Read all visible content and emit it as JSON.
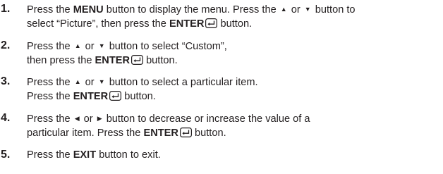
{
  "steps": [
    {
      "num": "1.",
      "lines": [
        [
          "Press the ",
          "MENU",
          " button to display the menu. Press the ",
          "▲",
          " or ",
          "▼",
          " button to"
        ],
        [
          "select “Picture”, then press the ",
          "ENTER",
          " button."
        ]
      ]
    },
    {
      "num": "2.",
      "lines": [
        [
          "Press the ",
          "▲",
          " or ",
          "▼",
          " button to select “Custom”,"
        ],
        [
          "then press the ",
          "ENTER",
          " button."
        ]
      ]
    },
    {
      "num": "3.",
      "lines": [
        [
          "Press the ",
          "▲",
          " or ",
          "▼",
          " button to select a particular item."
        ],
        [
          "Press the ",
          "ENTER",
          " button."
        ]
      ]
    },
    {
      "num": "4.",
      "lines": [
        [
          "Press the ",
          "◀",
          " or ",
          "▶",
          " button to decrease or increase the value of a"
        ],
        [
          "particular item. Press the ",
          "ENTER",
          " button."
        ]
      ]
    },
    {
      "num": "5.",
      "lines": [
        [
          "Press the ",
          "EXIT",
          " button to exit."
        ]
      ]
    }
  ],
  "icons": {
    "enter": "enter-key-icon",
    "up": "up-arrow-icon",
    "down": "down-arrow-icon",
    "left": "left-arrow-icon",
    "right": "right-arrow-icon"
  }
}
